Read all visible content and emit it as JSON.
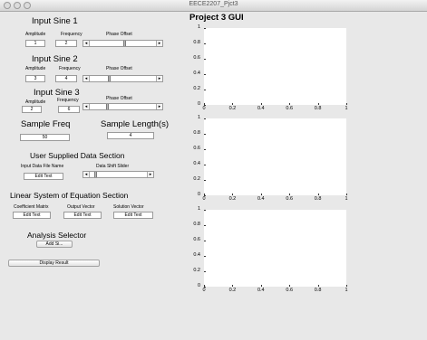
{
  "window": {
    "title": "EECE2207_Pjct3"
  },
  "gui_title": "Project 3 GUI",
  "sine1": {
    "heading": "Input Sine 1",
    "amp_label": "Amplitude",
    "freq_label": "Frequency",
    "phase_label": "Phase Offset",
    "amp_value": "1",
    "freq_value": "2"
  },
  "sine2": {
    "heading": "Input Sine 2",
    "amp_label": "Amplitude",
    "freq_label": "Frequency",
    "phase_label": "Phase Offset",
    "amp_value": "3",
    "freq_value": "4"
  },
  "sine3": {
    "heading": "Input Sine 3",
    "amp_label": "Amplitude",
    "freq_label": "Frequency",
    "phase_label": "Phase Offset",
    "amp_value": "2",
    "freq_value": "6"
  },
  "sample": {
    "freq_label": "Sample Freq",
    "length_label": "Sample Length(s)",
    "freq_value": "50",
    "length_value": "4"
  },
  "user_data": {
    "heading": "User Supplied Data Section",
    "file_label": "Input Data File Name",
    "file_value": "Edit Text",
    "slider_label": "Data Shift Slider"
  },
  "linear": {
    "heading": "Linear System of Equation Section",
    "coef_label": "Coefficient Matrix",
    "out_label": "Output Vector",
    "sol_label": "Solution Vector",
    "coef_value": "Edit Text",
    "out_value": "Edit Text",
    "sol_value": "Edit Text"
  },
  "analysis": {
    "heading": "Analysis Selector",
    "selected": "Add Si...",
    "display_label": "Display Result"
  },
  "sliders": {
    "phase1": 0.54,
    "phase2": 0.3,
    "phase3": 0.26,
    "shift": 0.08
  },
  "axes": {
    "y_ticks": [
      "0",
      "0.2",
      "0.4",
      "0.6",
      "0.8",
      "1"
    ],
    "x_ticks": [
      "0",
      "0.2",
      "0.4",
      "0.6",
      "0.8",
      "1"
    ]
  }
}
